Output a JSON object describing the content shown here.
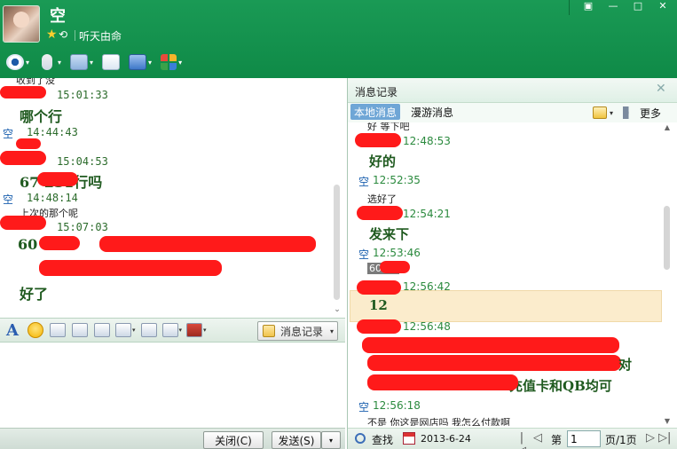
{
  "header": {
    "contact_name": "空",
    "signature": "听天由命",
    "window_controls": {
      "menu": "▣",
      "minimize": "—",
      "maximize": "□",
      "close": "✕"
    }
  },
  "toolbar": {
    "camera": "video-camera-icon",
    "mic": "microphone-icon",
    "file": "file-transfer-icon",
    "message": "message-icon",
    "screen": "screen-share-icon",
    "apps": "apps-grid-icon",
    "caret": "▾"
  },
  "chat": {
    "messages": [
      {
        "sender": "",
        "time": "",
        "body": "",
        "small": "收到了没"
      },
      {
        "sender": "",
        "time": "15:01:33",
        "body": "哪个行",
        "small": ""
      },
      {
        "sender": "空",
        "time": "14:44:43",
        "body": "",
        "small": ""
      },
      {
        "sender": "",
        "time": "15:04:53",
        "body": "67  231行吗",
        "small": ""
      },
      {
        "sender": "空",
        "time": "14:48:14",
        "body": "",
        "small": "上次的那个呢"
      },
      {
        "sender": "",
        "time": "15:07:03",
        "body": "60   91—",
        "small": ""
      },
      {
        "sender": "",
        "time": "",
        "body": "好了",
        "small": ""
      }
    ],
    "scroll_down": "⌄"
  },
  "input_toolbar": {
    "font_button": "A",
    "history_button": "消息记录",
    "caret": "▾"
  },
  "bottom_bar": {
    "close_button": "关闭(C)",
    "send_button": "发送(S)",
    "send_caret": "▾"
  },
  "history": {
    "title": "消息记录",
    "close": "✕",
    "tabs": [
      "本地消息",
      "漫游消息"
    ],
    "more": "更多",
    "messages": [
      {
        "sender": "",
        "time": "",
        "body": "",
        "small": "好 等下吧"
      },
      {
        "sender": "",
        "time": "12:48:53",
        "body": "",
        "small": ""
      },
      {
        "sender": "",
        "time": "",
        "body": "好的",
        "small": ""
      },
      {
        "sender": "空",
        "time": "12:52:35",
        "body": "",
        "small": ""
      },
      {
        "sender": "",
        "time": "",
        "body": "",
        "small": "选好了"
      },
      {
        "sender": "",
        "time": "12:54:21",
        "body": "",
        "small": ""
      },
      {
        "sender": "",
        "time": "",
        "body": "发来下",
        "small": ""
      },
      {
        "sender": "空",
        "time": "12:53:46",
        "body": "",
        "small": ""
      },
      {
        "sender": "",
        "time": "12:56:42",
        "body": "",
        "small": ""
      },
      {
        "sender": "",
        "time": "",
        "body": "12",
        "small": ""
      },
      {
        "sender": "",
        "time": "12:56:48",
        "body": "",
        "small": ""
      },
      {
        "sender": "",
        "time": "",
        "body": "对",
        "small": ""
      },
      {
        "sender": "",
        "time": "",
        "body": "充值卡和QB均可",
        "small": ""
      },
      {
        "sender": "空",
        "time": "12:56:18",
        "body": "",
        "small": ""
      },
      {
        "sender": "",
        "time": "",
        "body": "",
        "small": "不是 你这是网店吗 我怎么付款啊"
      }
    ],
    "selected_text": "60   91",
    "scroll_up": "▲",
    "scroll_down": "▼",
    "footer": {
      "search_label": "查找",
      "date": "2013-6-24",
      "page_prefix": "第",
      "page_value": "1",
      "page_total": "页/1页",
      "first": "|◁",
      "prev": "◁",
      "next": "▷",
      "last": "▷|"
    }
  },
  "colors": {
    "header_green": "#1a9a55",
    "time_green": "#2b8a3e",
    "sender_blue": "#1a5fae",
    "redaction_red": "#ff1a1a",
    "highlight": "#fbeccc"
  }
}
